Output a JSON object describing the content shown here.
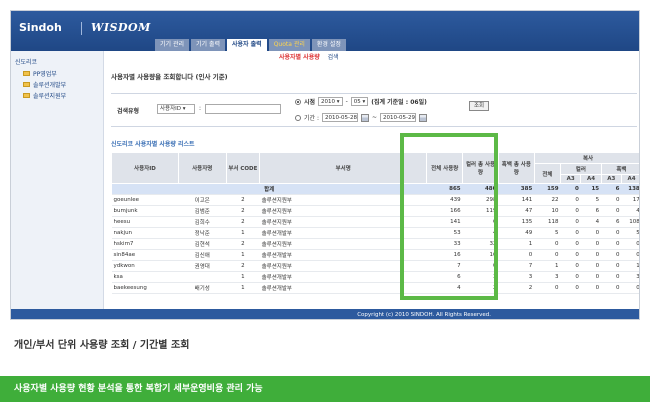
{
  "header": {
    "logo": "Sindoh",
    "product": "WISDOM",
    "tabs": [
      {
        "label": "기기 관리"
      },
      {
        "label": "기기 출력"
      },
      {
        "label": "사용자 출력"
      },
      {
        "label": "Quota 관리"
      },
      {
        "label": "환경 설정"
      }
    ],
    "subnav": {
      "active": "사용자별 사용량",
      "other": "검색"
    }
  },
  "sidebar": {
    "root": "신도리코",
    "items": [
      {
        "label": "PP영업부"
      },
      {
        "label": "솔루션개발부"
      },
      {
        "label": "솔루션지원부"
      }
    ]
  },
  "main": {
    "title": "사용자별 사용량을 조회합니다 (인사 기준)",
    "search": {
      "label": "검색유형",
      "type_value": "사용자ID",
      "colon": ":",
      "period_label": "시점",
      "year": "2010",
      "month": "05",
      "period_note": "(집계 기준일 : 06일)",
      "range_label": "기간 :",
      "from": "2010-05-28",
      "to": "2010-05-29",
      "tilde": "~",
      "button": "조회"
    },
    "list_title": "신도리코 사용자별 사용량 리스트",
    "columns": {
      "user_id": "사용자ID",
      "user_name": "사용자명",
      "dept_code": "부서 CODE",
      "dept_name": "부서명",
      "total": "전체 사용량",
      "color_total": "컬러 총 사용량",
      "bw_total": "흑백 총 사용량",
      "copy": "복사",
      "all": "전체",
      "color": "컬러",
      "bw": "흑백",
      "a3": "A3",
      "a4": "A4"
    },
    "total_row": {
      "label": "합계",
      "values": [
        "865",
        "480",
        "385",
        "159",
        "0",
        "15",
        "6",
        "138",
        "70"
      ]
    },
    "rows": [
      {
        "id": "goeunlee",
        "name": "이고은",
        "code": "2",
        "dept": "솔루션지원부",
        "v": [
          "439",
          "298",
          "141",
          "22",
          "0",
          "5",
          "0",
          "17",
          "41"
        ]
      },
      {
        "id": "bumjunk",
        "name": "김범준",
        "code": "2",
        "dept": "솔루션지원부",
        "v": [
          "166",
          "119",
          "47",
          "10",
          "0",
          "6",
          "0",
          "4",
          "15"
        ]
      },
      {
        "id": "heesu",
        "name": "김희수",
        "code": "2",
        "dept": "솔루션지원부",
        "v": [
          "141",
          "6",
          "135",
          "118",
          "0",
          "4",
          "6",
          "108",
          "2"
        ]
      },
      {
        "id": "nakjun",
        "name": "정낙준",
        "code": "1",
        "dept": "솔루션개발부",
        "v": [
          "53",
          "4",
          "49",
          "5",
          "0",
          "0",
          "0",
          "5",
          "4"
        ]
      },
      {
        "id": "hskim7",
        "name": "김현석",
        "code": "2",
        "dept": "솔루션지원부",
        "v": [
          "33",
          "32",
          "1",
          "0",
          "0",
          "0",
          "0",
          "0",
          "3"
        ]
      },
      {
        "id": "sin84ae",
        "name": "김신애",
        "code": "1",
        "dept": "솔루션개발부",
        "v": [
          "16",
          "16",
          "0",
          "0",
          "0",
          "0",
          "0",
          "0",
          "1"
        ]
      },
      {
        "id": "ydkwon",
        "name": "권영대",
        "code": "2",
        "dept": "솔루션지원부",
        "v": [
          "7",
          "0",
          "7",
          "1",
          "0",
          "0",
          "0",
          "1",
          "6"
        ]
      },
      {
        "id": "ksa",
        "name": "",
        "code": "1",
        "dept": "솔루션개발부",
        "v": [
          "6",
          "3",
          "3",
          "3",
          "0",
          "0",
          "0",
          "3",
          "0"
        ]
      },
      {
        "id": "baekeesung",
        "name": "배기성",
        "code": "1",
        "dept": "솔루션개발부",
        "v": [
          "4",
          "2",
          "2",
          "0",
          "0",
          "0",
          "0",
          "0",
          "4"
        ]
      }
    ]
  },
  "footer": {
    "copyright": "Copyright (c) 2010 SINDOH. All Rights Reserved."
  },
  "caption": "개인/부서 단위 사용량 조회 / 기간별 조회",
  "banner": "사용자별 사용량 현황 분석을 통한 복합기 세부운영비용 관리 가능"
}
